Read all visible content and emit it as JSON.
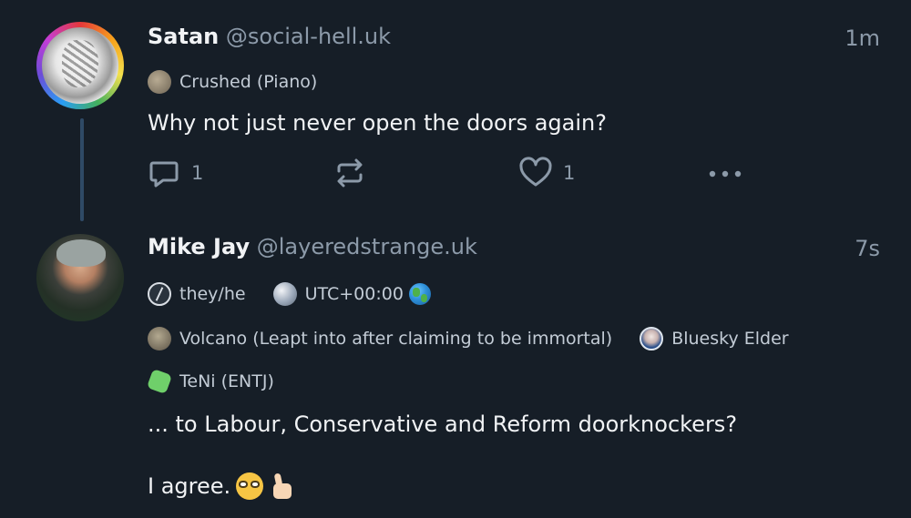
{
  "posts": [
    {
      "author_name": "Satan",
      "handle": "@social-hell.uk",
      "time": "1m",
      "badges": [
        {
          "icon": "piano-badge-icon",
          "label": "Crushed (Piano)"
        }
      ],
      "text": "Why not just never open the doors again?",
      "actions": {
        "reply_count": "1",
        "repost_count": "",
        "like_count": "1"
      }
    },
    {
      "author_name": "Mike Jay",
      "handle": "@layeredstrange.uk",
      "time": "7s",
      "badges_row1": [
        {
          "icon": "pronoun-slash-icon",
          "label": "they/he"
        },
        {
          "icon": "earth-icon",
          "label": "UTC+00:00",
          "suffix_icon": "globe-emoji-icon"
        }
      ],
      "badges_row2": [
        {
          "icon": "volcano-badge-icon",
          "label": "Volcano (Leapt into after claiming to be immortal)"
        },
        {
          "icon": "bluesky-elder-icon",
          "label": "Bluesky Elder"
        }
      ],
      "badges_row3": [
        {
          "icon": "puzzle-badge-icon",
          "label": "TeNi (ENTJ)"
        }
      ],
      "text_line1": "... to Labour, Conservative and Reform doorknockers?",
      "text_line2": "I agree.",
      "text_emojis": [
        "nerd-face-emoji",
        "thumbs-up-emoji"
      ]
    }
  ],
  "colors": {
    "background": "#161e27",
    "primary_text": "#f1f3f5",
    "secondary_text": "#8c9aa9",
    "thread_line": "#2f4a66"
  }
}
